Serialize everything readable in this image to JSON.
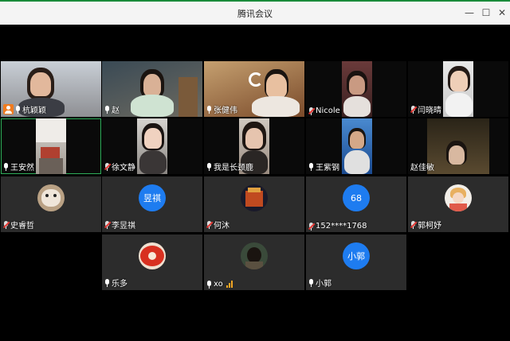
{
  "window": {
    "title": "腾讯会议"
  },
  "participants": [
    {
      "name": "杭颖颖",
      "host": true
    },
    {
      "name": "赵"
    },
    {
      "name": "张健伟"
    },
    {
      "name": "Nicole"
    },
    {
      "name": "闫晓晴"
    },
    {
      "name": "王安然"
    },
    {
      "name": "徐文静"
    },
    {
      "name": "我是长颈鹿"
    },
    {
      "name": "王紫钢"
    },
    {
      "name": "赵佳敏"
    },
    {
      "name": "史睿哲"
    },
    {
      "name": "李昱祺",
      "avatar_text": "昱祺"
    },
    {
      "name": "何沐"
    },
    {
      "name": "152****1768",
      "avatar_text": "68"
    },
    {
      "name": "郭柯妤"
    },
    {
      "name": "乐多"
    },
    {
      "name": "xo"
    },
    {
      "name": "小郭",
      "avatar_text": "小郭"
    }
  ]
}
